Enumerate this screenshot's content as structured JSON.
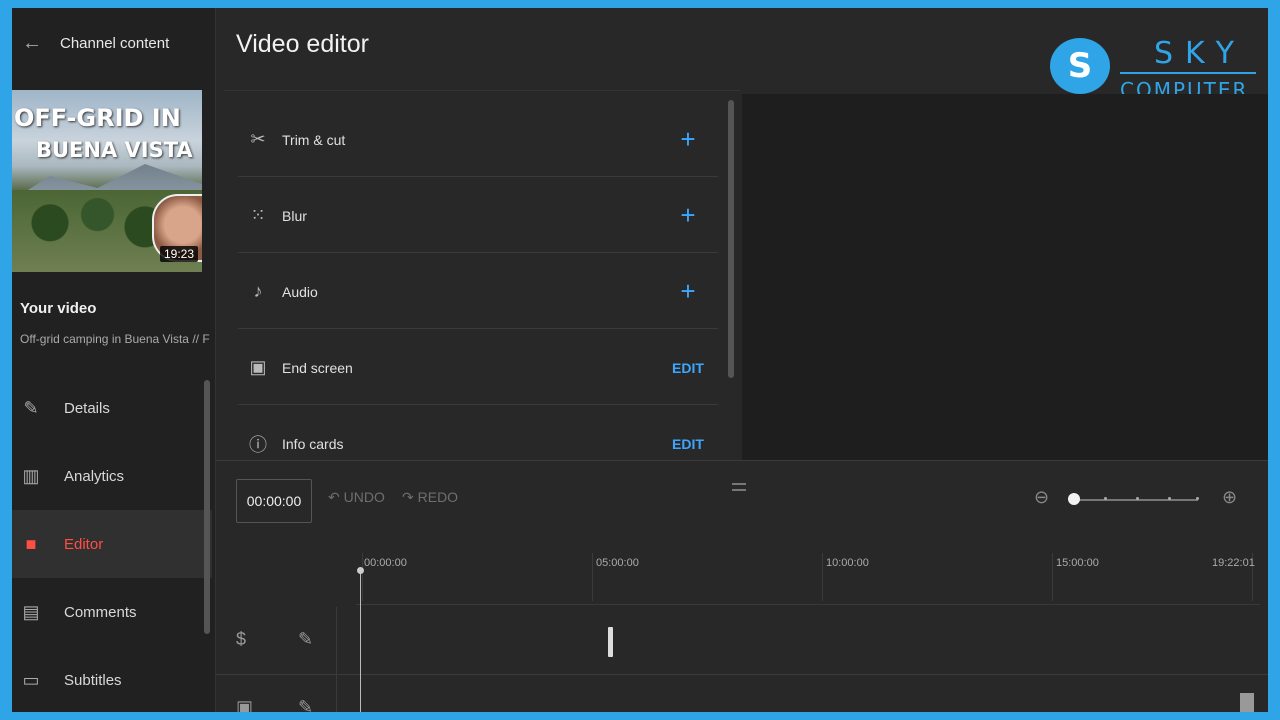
{
  "sidebar": {
    "back_label": "Channel content",
    "thumbnail": {
      "title_line1": "OFF-GRID IN",
      "title_line2": "BUENA VISTA",
      "duration": "19:23"
    },
    "your_video_label": "Your video",
    "video_title": "Off-grid camping in Buena Vista // Fi...",
    "nav": [
      {
        "label": "Details",
        "icon": "pencil-icon"
      },
      {
        "label": "Analytics",
        "icon": "analytics-icon"
      },
      {
        "label": "Editor",
        "icon": "clapperboard-icon",
        "active": true
      },
      {
        "label": "Comments",
        "icon": "comments-icon"
      },
      {
        "label": "Subtitles",
        "icon": "subtitles-icon"
      }
    ]
  },
  "header": {
    "title": "Video editor"
  },
  "watermark": {
    "brand": "SKY",
    "sub": "COMPUTER"
  },
  "tools": [
    {
      "label": "Trim & cut",
      "action": "+",
      "icon": "scissors-icon"
    },
    {
      "label": "Blur",
      "action": "+",
      "icon": "blur-icon"
    },
    {
      "label": "Audio",
      "action": "+",
      "icon": "music-note-icon"
    },
    {
      "label": "End screen",
      "action": "EDIT",
      "icon": "end-screen-icon"
    },
    {
      "label": "Info cards",
      "action": "EDIT",
      "icon": "info-icon"
    }
  ],
  "timeline": {
    "timecode": "00:00:00",
    "undo_label": "UNDO",
    "redo_label": "REDO",
    "ticks": [
      "00:00:00",
      "05:00:00",
      "10:00:00",
      "15:00:00",
      "19:22:01"
    ],
    "zoom_level": 0
  },
  "colors": {
    "accent_blue": "#3ea6ff",
    "active_red": "#ff4e45",
    "brand_blue": "#2fa4e7"
  }
}
